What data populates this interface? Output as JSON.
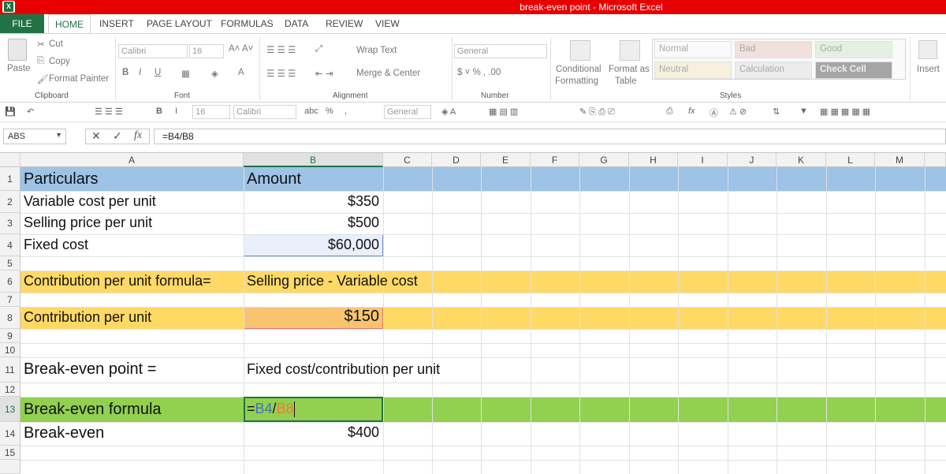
{
  "window": {
    "title": "break-even point  -  Microsoft Excel"
  },
  "tabs": [
    "FILE",
    "HOME",
    "INSERT",
    "PAGE LAYOUT",
    "FORMULAS",
    "DATA",
    "REVIEW",
    "VIEW"
  ],
  "ribbon": {
    "clipboard": {
      "paste": "Paste",
      "cut": "Cut",
      "copy": "Copy",
      "format_painter": "Format Painter",
      "label": "Clipboard"
    },
    "font": {
      "name": "Calibri",
      "size": "16",
      "label": "Font"
    },
    "alignment": {
      "wrap": "Wrap Text",
      "merge": "Merge & Center",
      "label": "Alignment"
    },
    "number": {
      "format": "General",
      "label": "Number"
    },
    "styles": {
      "conditional": "Conditional",
      "formatting": "Formatting",
      "format_as": "Format as",
      "table": "Table",
      "normal": "Normal",
      "bad": "Bad",
      "good": "Good",
      "neutral": "Neutral",
      "calculation": "Calculation",
      "check_cell": "Check Cell",
      "label": "Styles"
    },
    "insert": "Insert"
  },
  "qat": {
    "size": "16",
    "font": "Calibri",
    "format": "General"
  },
  "formula_bar": {
    "name_box": "ABS",
    "formula": "=B4/B8"
  },
  "columns": [
    "A",
    "B",
    "C",
    "D",
    "E",
    "F",
    "G",
    "H",
    "I",
    "J",
    "K",
    "L",
    "M"
  ],
  "rows": [
    "1",
    "2",
    "3",
    "4",
    "5",
    "6",
    "7",
    "8",
    "9",
    "10",
    "11",
    "12",
    "13",
    "14",
    "15"
  ],
  "cells": {
    "a1": "Particulars",
    "b1": "Amount",
    "a2": "Variable cost per unit",
    "b2": "$350",
    "a3": "Selling price per unit",
    "b3": "$500",
    "a4": "Fixed cost",
    "b4": "$60,000",
    "a6": "Contribution per unit formula=",
    "b6": "Selling price - Variable cost",
    "a8": "Contribution per unit",
    "b8": "$150",
    "a11": "Break-even point  =",
    "b11": "Fixed cost/contribution per unit",
    "a13": "Break-even formula",
    "b13_eq": "=",
    "b13_r1": "B4",
    "b13_slash": "/",
    "b13_r2": "B8",
    "a14": "Break-even",
    "b14": "$400"
  },
  "colors": {
    "excel_green": "#217346",
    "title_red": "#e60000",
    "header_blue": "#9dc3e6",
    "formula_orange": "#ffd966",
    "highlight_green": "#92d050",
    "ref_blue": "#4472c4",
    "ref_red": "#ed7d31"
  }
}
